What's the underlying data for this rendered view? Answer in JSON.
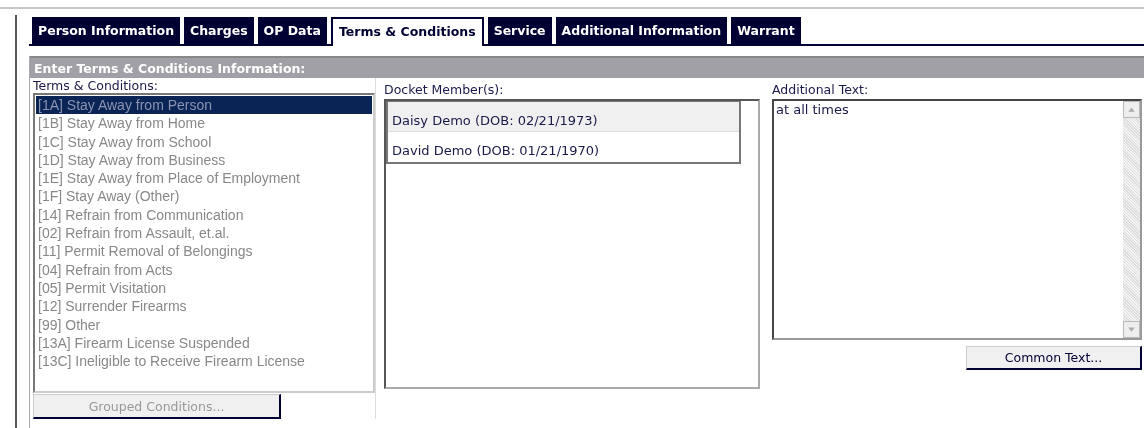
{
  "tabs": [
    {
      "label": "Person Information",
      "selected": false
    },
    {
      "label": "Charges",
      "selected": false
    },
    {
      "label": "OP Data",
      "selected": false
    },
    {
      "label": "Terms & Conditions",
      "selected": true
    },
    {
      "label": "Service",
      "selected": false
    },
    {
      "label": "Additional Information",
      "selected": false
    },
    {
      "label": "Warrant",
      "selected": false
    }
  ],
  "section_header": "Enter Terms & Conditions Information:",
  "terms": {
    "label": "Terms & Conditions:",
    "disabled": true,
    "items": [
      {
        "text": "[1A] Stay Away from Person",
        "selected": true
      },
      {
        "text": "[1B] Stay Away from Home",
        "selected": false
      },
      {
        "text": "[1C] Stay Away from School",
        "selected": false
      },
      {
        "text": "[1D] Stay Away from Business",
        "selected": false
      },
      {
        "text": "[1E] Stay Away from Place of Employment",
        "selected": false
      },
      {
        "text": "[1F] Stay Away (Other)",
        "selected": false
      },
      {
        "text": "[14] Refrain from Communication",
        "selected": false
      },
      {
        "text": "[02] Refrain from Assault, et.al.",
        "selected": false
      },
      {
        "text": "[11] Permit Removal of Belongings",
        "selected": false
      },
      {
        "text": "[04] Refrain from Acts",
        "selected": false
      },
      {
        "text": "[05] Permit Visitation",
        "selected": false
      },
      {
        "text": "[12] Surrender Firearms",
        "selected": false
      },
      {
        "text": "[99] Other",
        "selected": false
      },
      {
        "text": "[13A] Firearm License Suspended",
        "selected": false
      },
      {
        "text": "[13C] Ineligible to Receive Firearm License",
        "selected": false
      }
    ],
    "button": {
      "label": "Grouped Conditions...",
      "disabled": true
    }
  },
  "docket_members": {
    "label": "Docket Member(s):",
    "items": [
      {
        "text": "Daisy Demo (DOB: 02/21/1973)",
        "selected": true
      },
      {
        "text": "David Demo (DOB: 01/21/1970)",
        "selected": false
      }
    ]
  },
  "additional_text": {
    "label": "Additional Text:",
    "value": "at all times",
    "button": {
      "label": "Common Text...",
      "disabled": false
    }
  }
}
